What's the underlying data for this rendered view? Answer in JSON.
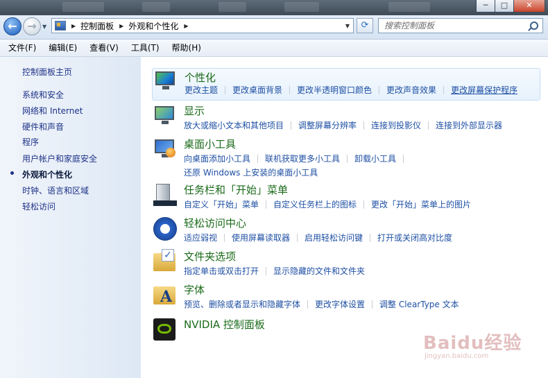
{
  "window": {
    "title_buttons": [
      "─",
      "□",
      "✕"
    ]
  },
  "nav": {
    "breadcrumbs": [
      "控制面板",
      "外观和个性化"
    ],
    "search_placeholder": "搜索控制面板"
  },
  "menubar": [
    "文件(F)",
    "编辑(E)",
    "查看(V)",
    "工具(T)",
    "帮助(H)"
  ],
  "sidebar": {
    "home": "控制面板主页",
    "items": [
      "系统和安全",
      "网络和 Internet",
      "硬件和声音",
      "程序",
      "用户帐户和家庭安全",
      "外观和个性化",
      "时钟、语言和区域",
      "轻松访问"
    ],
    "active_index": 5
  },
  "categories": [
    {
      "title": "个性化",
      "icon": "personalization-icon",
      "links": [
        "更改主题",
        "更改桌面背景",
        "更改半透明窗口颜色",
        "更改声音效果",
        "更改屏幕保护程序"
      ]
    },
    {
      "title": "显示",
      "icon": "display-icon",
      "links": [
        "放大或缩小文本和其他项目",
        "调整屏幕分辨率",
        "连接到投影仪",
        "连接到外部显示器"
      ]
    },
    {
      "title": "桌面小工具",
      "icon": "desktop-gadgets-icon",
      "links": [
        "向桌面添加小工具",
        "联机获取更多小工具",
        "卸载小工具",
        "还原 Windows 上安装的桌面小工具"
      ]
    },
    {
      "title": "任务栏和「开始」菜单",
      "icon": "taskbar-icon",
      "links": [
        "自定义「开始」菜单",
        "自定义任务栏上的图标",
        "更改「开始」菜单上的图片"
      ]
    },
    {
      "title": "轻松访问中心",
      "icon": "ease-of-access-icon",
      "links": [
        "适应弱视",
        "使用屏幕读取器",
        "启用轻松访问键",
        "打开或关闭高对比度"
      ]
    },
    {
      "title": "文件夹选项",
      "icon": "folder-options-icon",
      "links": [
        "指定单击或双击打开",
        "显示隐藏的文件和文件夹"
      ]
    },
    {
      "title": "字体",
      "icon": "fonts-icon",
      "links": [
        "预览、删除或者显示和隐藏字体",
        "更改字体设置",
        "调整 ClearType 文本"
      ]
    },
    {
      "title": "NVIDIA 控制面板",
      "icon": "nvidia-icon",
      "links": []
    }
  ],
  "watermark": {
    "text": "Baidu经验",
    "sub": "jingyan.baidu.com"
  },
  "colors": {
    "category_title": "#1a6a1a",
    "link": "#1e4fa3",
    "sidebar_link": "#1e3287"
  }
}
